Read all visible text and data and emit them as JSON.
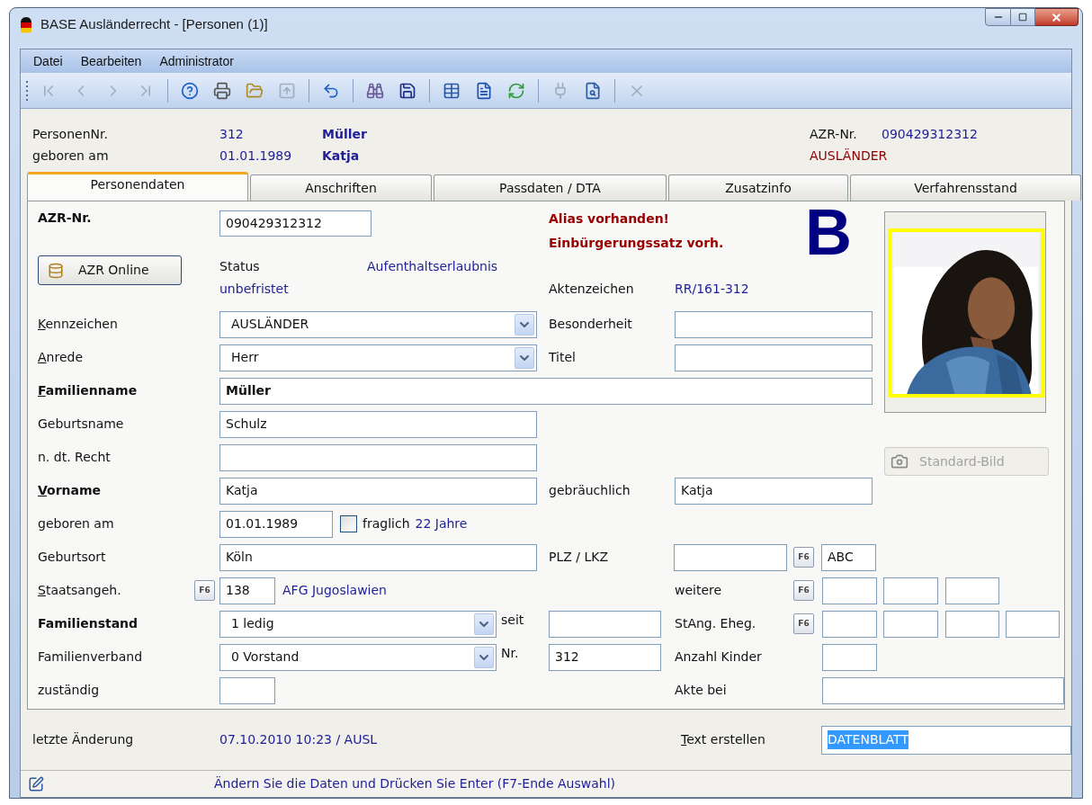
{
  "window": {
    "title": "BASE Ausländerrecht - [Personen (1)]"
  },
  "menu": [
    {
      "label": "Datei"
    },
    {
      "label": "Bearbeiten"
    },
    {
      "label": "Administrator"
    }
  ],
  "toolbar": [
    [
      {
        "disabled": true
      },
      {
        "disabled": true
      },
      {
        "disabled": true
      },
      {
        "disabled": true
      }
    ],
    [
      {
        "disabled": false
      },
      {
        "disabled": false
      },
      {
        "disabled": false
      },
      {
        "disabled": true
      }
    ],
    [
      {
        "disabled": false
      }
    ],
    [
      {
        "disabled": false
      },
      {
        "disabled": false
      }
    ],
    [
      {
        "disabled": false
      },
      {
        "disabled": false
      },
      {
        "disabled": false
      }
    ],
    [
      {
        "disabled": true
      },
      {
        "disabled": false
      }
    ],
    [
      {
        "disabled": true
      }
    ]
  ],
  "header": {
    "person_nr": {
      "label": "PersonenNr.",
      "value": "312"
    },
    "birth": {
      "label": "geboren am",
      "value": "01.01.1989"
    },
    "surname": "Müller",
    "first_name": "Katja",
    "azr": {
      "label": "AZR-Nr.",
      "value": "090429312312"
    },
    "marker": "AUSLÄNDER"
  },
  "tabs": [
    {
      "label": "Personendaten",
      "selected": true
    },
    {
      "label": "Anschriften",
      "selected": false
    },
    {
      "label": "Passdaten / DTA",
      "selected": false
    },
    {
      "label": "Zusatzinfo",
      "selected": false
    },
    {
      "label": "Verfahrensstand",
      "selected": false
    }
  ],
  "form": {
    "azr_nr": {
      "label": "AZR-Nr.",
      "bold": true,
      "value": "090429312312"
    },
    "azr_online": {
      "label": "AZR Online"
    },
    "alerts": [
      "Alias vorhanden!",
      "Einbürgerungssatz vorh."
    ],
    "badge": "B",
    "status": {
      "label": "Status",
      "value": [
        "Aufenthaltserlaubnis",
        "unbefristet"
      ]
    },
    "file_ref": {
      "label": "Aktenzeichen",
      "value": "RR/161-312"
    },
    "kennzeichen": {
      "label": "Kennzeichen",
      "access_key": true,
      "value": "AUSLÄNDER"
    },
    "besonderheit": {
      "label": "Besonderheit"
    },
    "anrede": {
      "label": "Anrede",
      "access_key": true,
      "value": "Herr"
    },
    "titel": {
      "label": "Titel"
    },
    "familienname": {
      "label": "Familienname",
      "access_key": true,
      "bold": true,
      "value": "Müller"
    },
    "geburtsname": {
      "label": "Geburtsname",
      "value": "Schulz"
    },
    "recht": {
      "label": "n. dt. Recht"
    },
    "vorname": {
      "label": "Vorname",
      "access_key": true,
      "bold": true,
      "value": "Katja"
    },
    "rufname": {
      "label": "gebräuchlich",
      "value": "Katja"
    },
    "geboren": {
      "label": "geboren am",
      "value": "01.01.1989",
      "questionable": {
        "label": "fraglich",
        "checked": false
      },
      "age": "22 Jahre"
    },
    "geburtsort": {
      "label": "Geburtsort",
      "value": "Köln"
    },
    "plz": {
      "label": "PLZ / LKZ",
      "f6": "F6",
      "country": "ABC"
    },
    "staat": {
      "label": "Staatsangeh.",
      "access_key": true,
      "f6": "F6",
      "code": "138",
      "name": "AFG Jugoslawien"
    },
    "weitere": {
      "label": "weitere",
      "f6": "F6"
    },
    "familienstand": {
      "label": "Familienstand",
      "bold": true,
      "value": "1 ledig"
    },
    "seit": {
      "label": "seit"
    },
    "stang": {
      "label": "StAng. Eheg.",
      "f6": "F6"
    },
    "familienverband": {
      "label": "Familienverband",
      "value": "0 Vorstand"
    },
    "nr": {
      "label": "Nr.",
      "value": "312"
    },
    "kinder": {
      "label": "Anzahl Kinder"
    },
    "zustaendig": {
      "label": "zuständig"
    },
    "akte": {
      "label": "Akte bei"
    },
    "photo": {
      "kind": "picture",
      "button": {
        "label": "Standard-Bild",
        "disabled": true
      }
    }
  },
  "footer": {
    "changed": {
      "label": "letzte Änderung",
      "value": "07.10.2010 10:23 / AUSL"
    },
    "text": {
      "label": "Text erstellen",
      "access_key": true,
      "value": "DATENBLATT",
      "highlighted": true
    }
  },
  "status_bar": {
    "message": "Ändern Sie die Daten und Drücken Sie Enter (F7-Ende Auswahl)"
  }
}
